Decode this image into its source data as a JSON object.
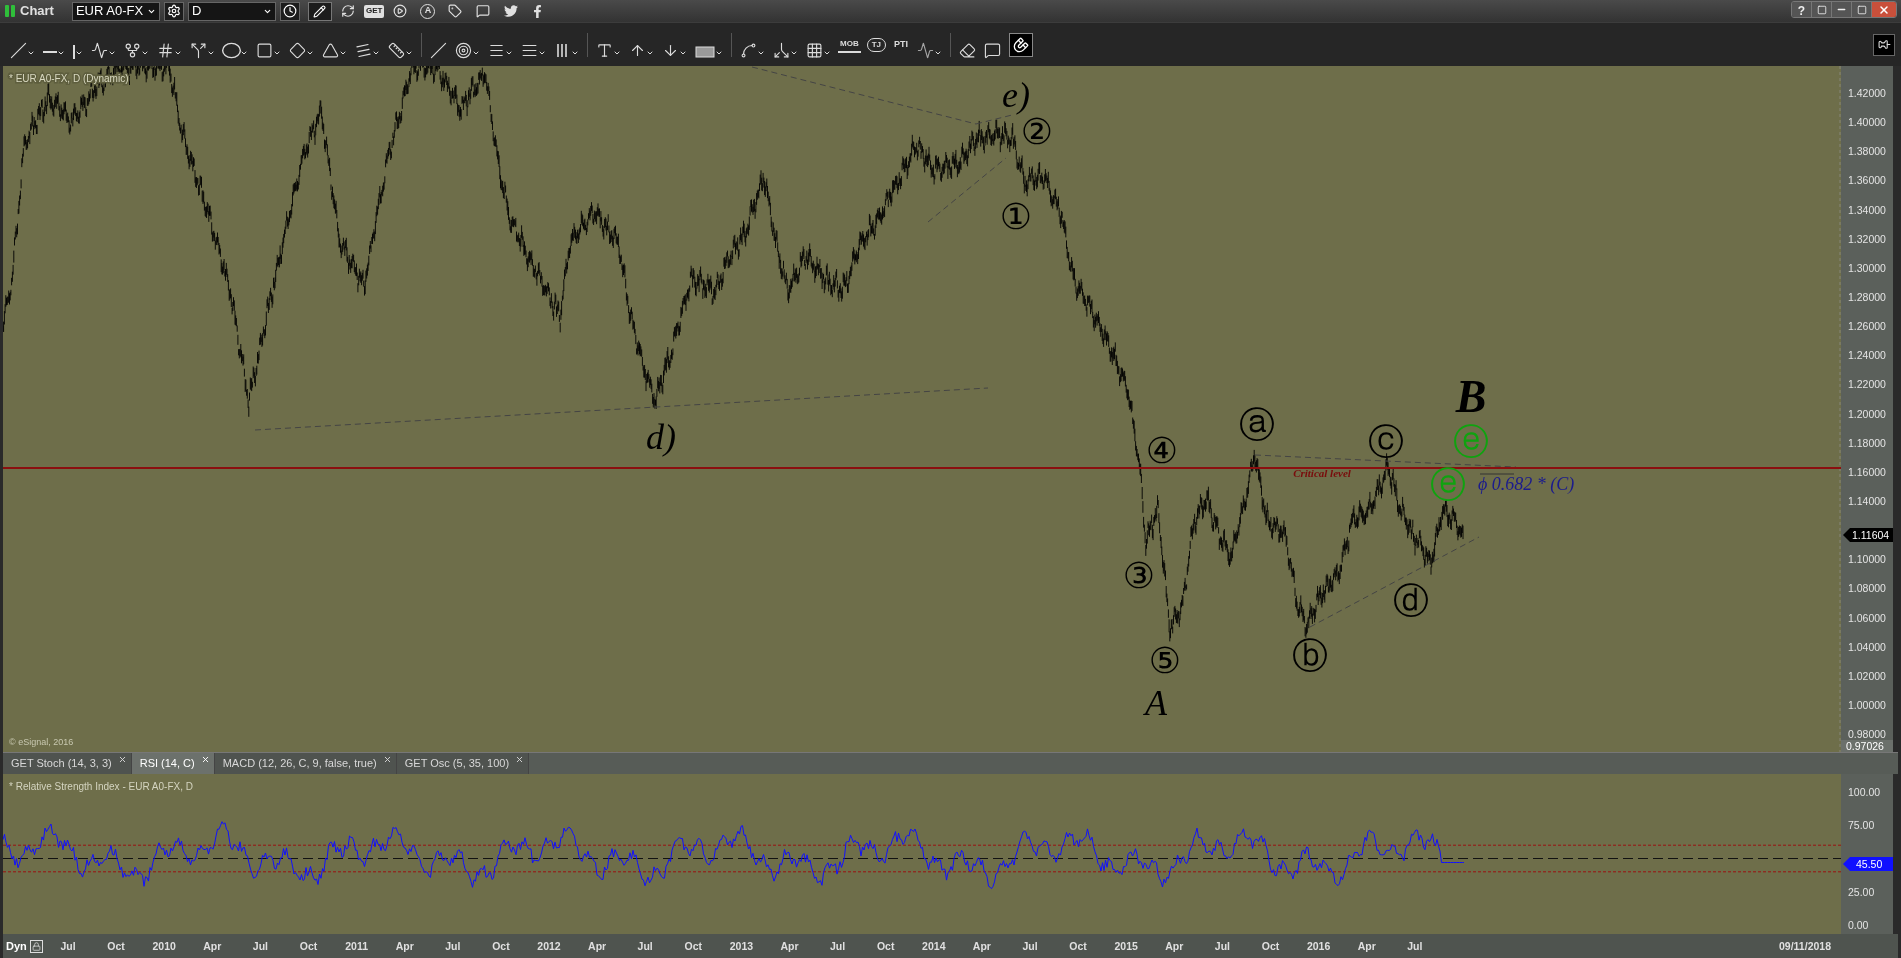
{
  "window": {
    "title": "Chart",
    "help_label": "?"
  },
  "title_bar": {
    "symbol": "EUR A0-FX",
    "interval": "D",
    "get_label": "GET",
    "a_label": "A"
  },
  "drawing_toolbar": {
    "mob_label": "MOB",
    "tj_label": "TJ",
    "pti_label": "PTI"
  },
  "chart": {
    "legend": "* EUR A0-FX, D (Dynamic)",
    "copyright": "© eSignal, 2016",
    "price_ticks": [
      "1.42000",
      "1.40000",
      "1.38000",
      "1.36000",
      "1.34000",
      "1.32000",
      "1.30000",
      "1.28000",
      "1.26000",
      "1.24000",
      "1.22000",
      "1.20000",
      "1.18000",
      "1.16000",
      "1.14000",
      "1.10000",
      "1.08000",
      "1.06000",
      "1.04000",
      "1.02000",
      "1.00000",
      "0.98000"
    ],
    "last_price": "1.11604",
    "low_price": "0.97026",
    "critical_level_label": "Critical level",
    "fib_label": "ϕ 0.682 * (C)",
    "annotations": [
      {
        "text": "e)",
        "kind": "degree",
        "color": "#000000"
      },
      {
        "text": "②",
        "kind": "circled",
        "color": "#000000"
      },
      {
        "text": "①",
        "kind": "circled",
        "color": "#000000"
      },
      {
        "text": "d)",
        "kind": "degree",
        "color": "#000000"
      },
      {
        "text": "④",
        "kind": "circled",
        "color": "#000000"
      },
      {
        "text": "ⓐ",
        "kind": "circled",
        "color": "#000000"
      },
      {
        "text": "ⓒ",
        "kind": "circled",
        "color": "#000000"
      },
      {
        "text": "B",
        "kind": "degree",
        "color": "#000000"
      },
      {
        "text": "ⓔ",
        "kind": "circled",
        "color": "#0fa30f"
      },
      {
        "text": "ⓔ",
        "kind": "circled",
        "color": "#0fa30f"
      },
      {
        "text": "③",
        "kind": "circled",
        "color": "#000000"
      },
      {
        "text": "ⓓ",
        "kind": "circled",
        "color": "#000000"
      },
      {
        "text": "ⓑ",
        "kind": "circled",
        "color": "#000000"
      },
      {
        "text": "⑤",
        "kind": "circled",
        "color": "#000000"
      },
      {
        "text": "A",
        "kind": "degree",
        "color": "#000000"
      }
    ]
  },
  "indicator_tabs": [
    {
      "label": "GET Stoch (14, 3, 3)",
      "selected": false
    },
    {
      "label": "RSI (14, C)",
      "selected": true
    },
    {
      "label": "MACD (12, 26, C, 9, false, true)",
      "selected": false
    },
    {
      "label": "GET Osc (5, 35, 100)",
      "selected": false
    }
  ],
  "rsi": {
    "legend": "* Relative Strength Index - EUR A0-FX, D",
    "ticks": [
      "100.00",
      "75.00",
      "25.00",
      "0.00"
    ],
    "last_value": "45.50"
  },
  "time_axis": {
    "mode": "Dyn",
    "labels": [
      "Jul",
      "Oct",
      "2010",
      "Apr",
      "Jul",
      "Oct",
      "2011",
      "Apr",
      "Jul",
      "Oct",
      "2012",
      "Apr",
      "Jul",
      "Oct",
      "2013",
      "Apr",
      "Jul",
      "Oct",
      "2014",
      "Apr",
      "Jul",
      "Oct",
      "2015",
      "Apr",
      "Jul",
      "Oct",
      "2016",
      "Apr",
      "Jul"
    ],
    "date": "09/11/2018"
  }
}
